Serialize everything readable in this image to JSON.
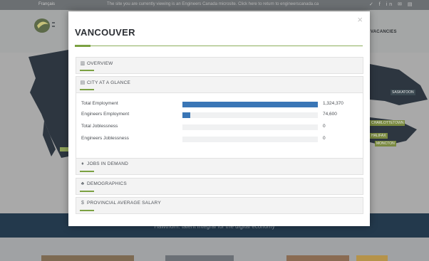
{
  "background": {
    "top_bar": {
      "language": "Français",
      "notice": "The site you are currently viewing is an Engineers Canada microsite. Click here to return to engineerscanada.ca"
    },
    "nav": {
      "vacancies": "VACANCIES"
    },
    "map_cities": [
      "SASKATOON",
      "CHARLOTTETOWN",
      "HALIFAX",
      "MONCTON"
    ],
    "tagline": "Hawthorn: talent integral for the digital economy"
  },
  "modal": {
    "title": "VANCOUVER",
    "close_glyph": "×",
    "sections": {
      "overview": {
        "label": "OVERVIEW",
        "icon": "bar-chart-icon"
      },
      "city_at_a_glance": {
        "label": "CITY AT A GLANCE",
        "icon": "document-icon"
      },
      "jobs_in_demand": {
        "label": "JOBS IN DEMAND",
        "icon": "person-icon"
      },
      "demographics": {
        "label": "DEMOGRAPHICS",
        "icon": "group-icon"
      },
      "provincial_average_salary": {
        "label": "PROVINCIAL AVERAGE SALARY",
        "icon": "dollar-icon"
      }
    },
    "stats": [
      {
        "label": "Total Employment",
        "value": "1,324,370",
        "fill_fraction": 1.0
      },
      {
        "label": "Engineers Employment",
        "value": "74,600",
        "fill_fraction": 0.056
      },
      {
        "label": "Total Joblessness",
        "value": "0",
        "fill_fraction": 0
      },
      {
        "label": "Engineers Joblessness",
        "value": "0",
        "fill_fraction": 0
      }
    ]
  },
  "colors": {
    "accent_green": "#7ba142",
    "bar_blue": "#3a76b6",
    "overlay_dark": "#23394c"
  }
}
